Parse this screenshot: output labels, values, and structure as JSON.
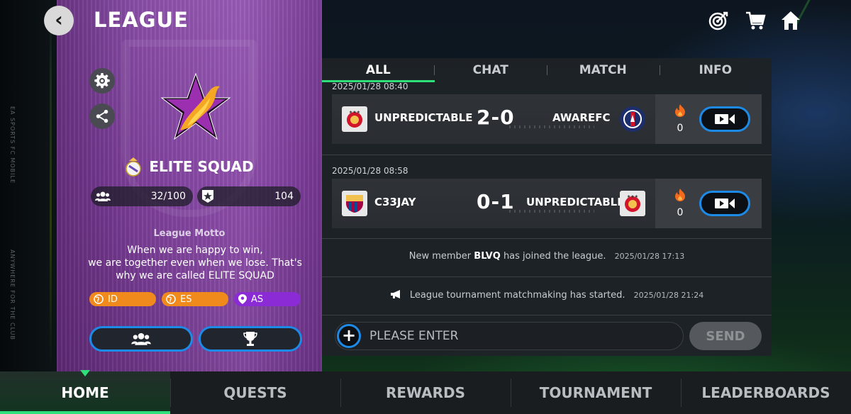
{
  "header": {
    "title": "LEAGUE",
    "back_icon": "chevron-left-icon",
    "top_icons": [
      "target-icon",
      "cart-icon",
      "home-icon"
    ]
  },
  "background": {
    "side_text_1": "EA SPORTS FC MOBILE",
    "side_text_2": "ANYWHERE FOR THE CLUB"
  },
  "league": {
    "name": "ELITE SQUAD",
    "members": "32/100",
    "rating": "104",
    "motto_label": "League Motto",
    "motto_lines": [
      "When we are happy to win,",
      "we are together even when we lose. That's",
      "why we are called ELITE SQUAD"
    ],
    "tags": [
      {
        "label": "ID",
        "icon": "globe-icon",
        "color": "#f08a1c"
      },
      {
        "label": "ES",
        "icon": "globe-icon",
        "color": "#f08a1c"
      },
      {
        "label": "AS",
        "icon": "location-pin-icon",
        "color": "#8a2bd6"
      }
    ],
    "buttons": [
      "members-icon",
      "trophy-icon"
    ]
  },
  "feed": {
    "tabs": [
      {
        "label": "ALL",
        "active": true
      },
      {
        "label": "CHAT",
        "active": false
      },
      {
        "label": "MATCH",
        "active": false
      },
      {
        "label": "INFO",
        "active": false
      }
    ],
    "matches": [
      {
        "timestamp": "2025/01/28 08:40",
        "home_team": "UNPREDICTABLE",
        "score": "2-0",
        "away_team": "AWAREFC",
        "reactions": "0"
      },
      {
        "timestamp": "2025/01/28 08:58",
        "home_team": "C33JAY",
        "score": "0-1",
        "away_team": "UNPREDICTABLE",
        "reactions": "0"
      }
    ],
    "system_messages": [
      {
        "prefix": "New member",
        "highlight": "BLVQ",
        "suffix": "has joined the league.",
        "time": "2025/01/28 17:13"
      },
      {
        "text": "League tournament matchmaking has started.",
        "time": "2025/01/28 21:24"
      }
    ],
    "input_placeholder": "PLEASE ENTER",
    "send_label": "SEND"
  },
  "bottom_nav": [
    {
      "label": "HOME",
      "active": true
    },
    {
      "label": "QUESTS",
      "active": false
    },
    {
      "label": "REWARDS",
      "active": false
    },
    {
      "label": "TOURNAMENT",
      "active": false
    },
    {
      "label": "LEADERBOARDS",
      "active": false
    }
  ],
  "colors": {
    "accent_green": "#2fe07a",
    "accent_blue": "#1c8ae6",
    "banner_purple": "#7d3f9a"
  }
}
